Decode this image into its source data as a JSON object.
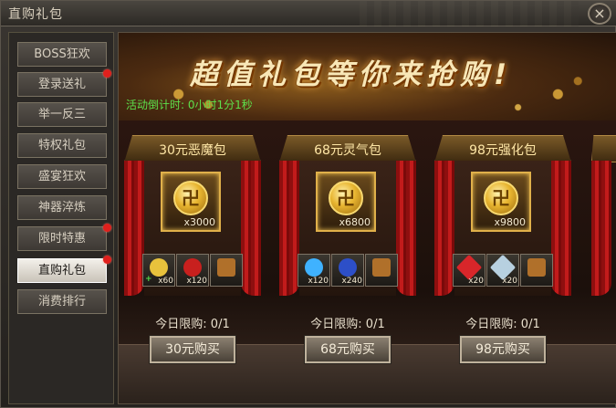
{
  "window": {
    "title": "直购礼包",
    "close_label": "×"
  },
  "sidebar": {
    "items": [
      {
        "label": "BOSS狂欢",
        "active": false,
        "dot": false
      },
      {
        "label": "登录送礼",
        "active": false,
        "dot": true
      },
      {
        "label": "举一反三",
        "active": false,
        "dot": false
      },
      {
        "label": "特权礼包",
        "active": false,
        "dot": false
      },
      {
        "label": "盛宴狂欢",
        "active": false,
        "dot": false
      },
      {
        "label": "神器淬炼",
        "active": false,
        "dot": false
      },
      {
        "label": "限时特惠",
        "active": false,
        "dot": true
      },
      {
        "label": "直购礼包",
        "active": true,
        "dot": true
      },
      {
        "label": "消费排行",
        "active": false,
        "dot": false
      }
    ]
  },
  "banner": {
    "headline": "超值礼包等你来抢购!",
    "countdown_label": "活动倒计时: 0小时1分1秒"
  },
  "packs": [
    {
      "name": "30元恶魔包",
      "main_qty": "x3000",
      "items": [
        {
          "qty": "x60",
          "icon": "yellow-gem-icon",
          "color": "#e8c23c"
        },
        {
          "qty": "x120",
          "icon": "red-orb-icon",
          "color": "#c8201e"
        },
        {
          "qty": "",
          "icon": "treasure-chest-icon",
          "color": "#b0702a"
        }
      ],
      "limit": "今日限购: 0/1",
      "buy_label": "30元购买"
    },
    {
      "name": "68元灵气包",
      "main_qty": "x6800",
      "items": [
        {
          "qty": "x120",
          "icon": "blue-flame-icon",
          "color": "#3fb2ff"
        },
        {
          "qty": "x240",
          "icon": "blue-orb-icon",
          "color": "#2d4fc8"
        },
        {
          "qty": "",
          "icon": "treasure-chest-icon",
          "color": "#b0702a"
        }
      ],
      "limit": "今日限购: 0/1",
      "buy_label": "68元购买"
    },
    {
      "name": "98元强化包",
      "main_qty": "x9800",
      "items": [
        {
          "qty": "x20",
          "icon": "red-crystal-icon",
          "color": "#d8262a"
        },
        {
          "qty": "x20",
          "icon": "silver-crystal-icon",
          "color": "#b7d0e0"
        },
        {
          "qty": "",
          "icon": "treasure-chest-icon",
          "color": "#b0702a"
        }
      ],
      "limit": "今日限购: 0/1",
      "buy_label": "98元购买"
    }
  ]
}
